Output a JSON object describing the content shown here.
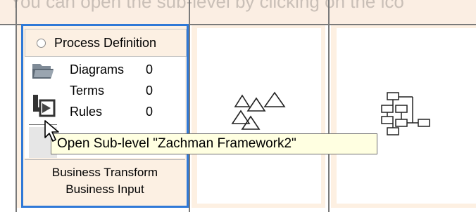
{
  "top_text": "You can open the sub-level by clicking on the ico",
  "panel": {
    "title": "Process Definition",
    "counts": [
      {
        "name": "Diagrams",
        "value": "0"
      },
      {
        "name": "Terms",
        "value": "0"
      },
      {
        "name": "Rules",
        "value": "0"
      }
    ],
    "footer_line1": "Business Transform",
    "footer_line2": "Business Input"
  },
  "tooltip": "Open Sub-level \"Zachman Framework2\"",
  "icons": [
    "folder-icon",
    "open-sublevel-icon",
    "triangles-icon",
    "hierarchy-icon",
    "mouse-cursor-icon"
  ]
}
